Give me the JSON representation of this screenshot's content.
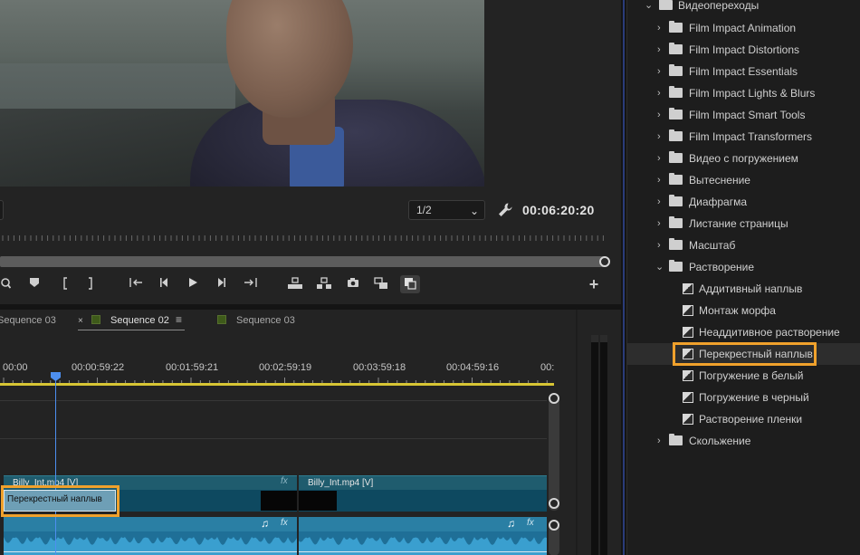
{
  "monitor": {
    "scale_value": "1/2",
    "timecode": "00:06:20:20"
  },
  "timeline": {
    "tabs": [
      {
        "label": "Sequence 03"
      },
      {
        "label": "Sequence 02",
        "active": true
      },
      {
        "label": "Sequence 03"
      }
    ],
    "ruler_labels": [
      "00:00",
      "00:00:59:22",
      "00:01:59:21",
      "00:02:59:19",
      "00:03:59:18",
      "00:04:59:16",
      "00:"
    ],
    "v1_clip_left_label": "Billy_Int.mp4 [V]",
    "v1_clip_right_label": "Billy_Int.mp4 [V]",
    "fx_label": "fx",
    "transition_label": "Перекрестный наплыв",
    "audio_note": "♫"
  },
  "effects": {
    "root_folder": "Видеопереходы",
    "folders": [
      "Film Impact Animation",
      "Film Impact Distortions",
      "Film Impact Essentials",
      "Film Impact Lights & Blurs",
      "Film Impact Smart Tools",
      "Film Impact Transformers",
      "Видео с погружением",
      "Вытеснение",
      "Диафрагма",
      "Листание страницы",
      "Масштаб"
    ],
    "open_folder": "Растворение",
    "items": [
      "Аддитивный наплыв",
      "Монтаж морфа",
      "Неаддитивное растворение",
      "Перекрестный наплыв",
      "Погружение в белый",
      "Погружение в черный",
      "Растворение пленки"
    ],
    "selected_item": "Перекрестный наплыв",
    "last_folder": "Скольжение"
  },
  "colors": {
    "highlight": "#f0a12c",
    "playhead": "#4d8ff0",
    "work_area": "#d7c534",
    "video_clip": "#0e4960",
    "audio_clip": "#3a9fcf"
  }
}
